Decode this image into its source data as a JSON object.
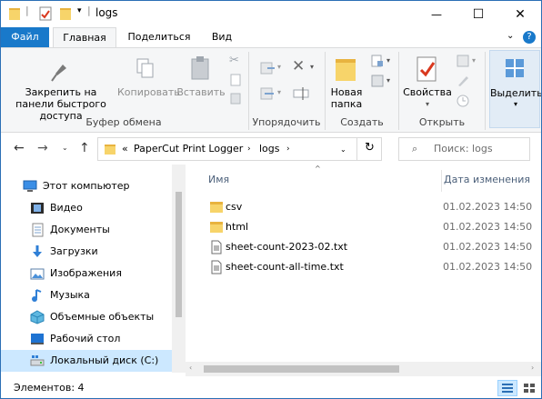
{
  "window": {
    "title": "logs",
    "minimize_glyph": "—",
    "maximize_glyph": "☐",
    "close_glyph": "✕"
  },
  "ribbon_tabs": {
    "file": "Файл",
    "home": "Главная",
    "share": "Поделиться",
    "view": "Вид",
    "expand_glyph": "⌄",
    "help_glyph": "?"
  },
  "ribbon": {
    "pin_label": "Закрепить на панели быстрого доступа",
    "copy_label": "Копировать",
    "paste_label": "Вставить",
    "clipboard_group": "Буфер обмена",
    "organize_group": "Упорядочить",
    "new_folder_label": "Новая папка",
    "create_group": "Создать",
    "properties_label": "Свойства",
    "open_group": "Открыть",
    "select_label": "Выделить"
  },
  "address": {
    "overflow": "«",
    "crumbs": [
      "PaperCut Print Logger",
      "logs"
    ],
    "search_placeholder": "Поиск: logs"
  },
  "nav": {
    "items": [
      {
        "label": "Этот компьютер",
        "icon": "computer-icon"
      },
      {
        "label": "Видео",
        "icon": "video-icon"
      },
      {
        "label": "Документы",
        "icon": "documents-icon"
      },
      {
        "label": "Загрузки",
        "icon": "downloads-icon"
      },
      {
        "label": "Изображения",
        "icon": "pictures-icon"
      },
      {
        "label": "Музыка",
        "icon": "music-icon"
      },
      {
        "label": "Объемные объекты",
        "icon": "3d-objects-icon"
      },
      {
        "label": "Рабочий стол",
        "icon": "desktop-icon"
      },
      {
        "label": "Локальный диск (C:)",
        "icon": "drive-icon"
      }
    ]
  },
  "content": {
    "columns": {
      "name": "Имя",
      "modified": "Дата изменения"
    },
    "files": [
      {
        "name": "csv",
        "modified": "01.02.2023 14:50",
        "type": "folder"
      },
      {
        "name": "html",
        "modified": "01.02.2023 14:50",
        "type": "folder"
      },
      {
        "name": "sheet-count-2023-02.txt",
        "modified": "01.02.2023 14:50",
        "type": "text"
      },
      {
        "name": "sheet-count-all-time.txt",
        "modified": "01.02.2023 14:50",
        "type": "text"
      }
    ]
  },
  "status": {
    "items_count": "Элементов: 4"
  }
}
